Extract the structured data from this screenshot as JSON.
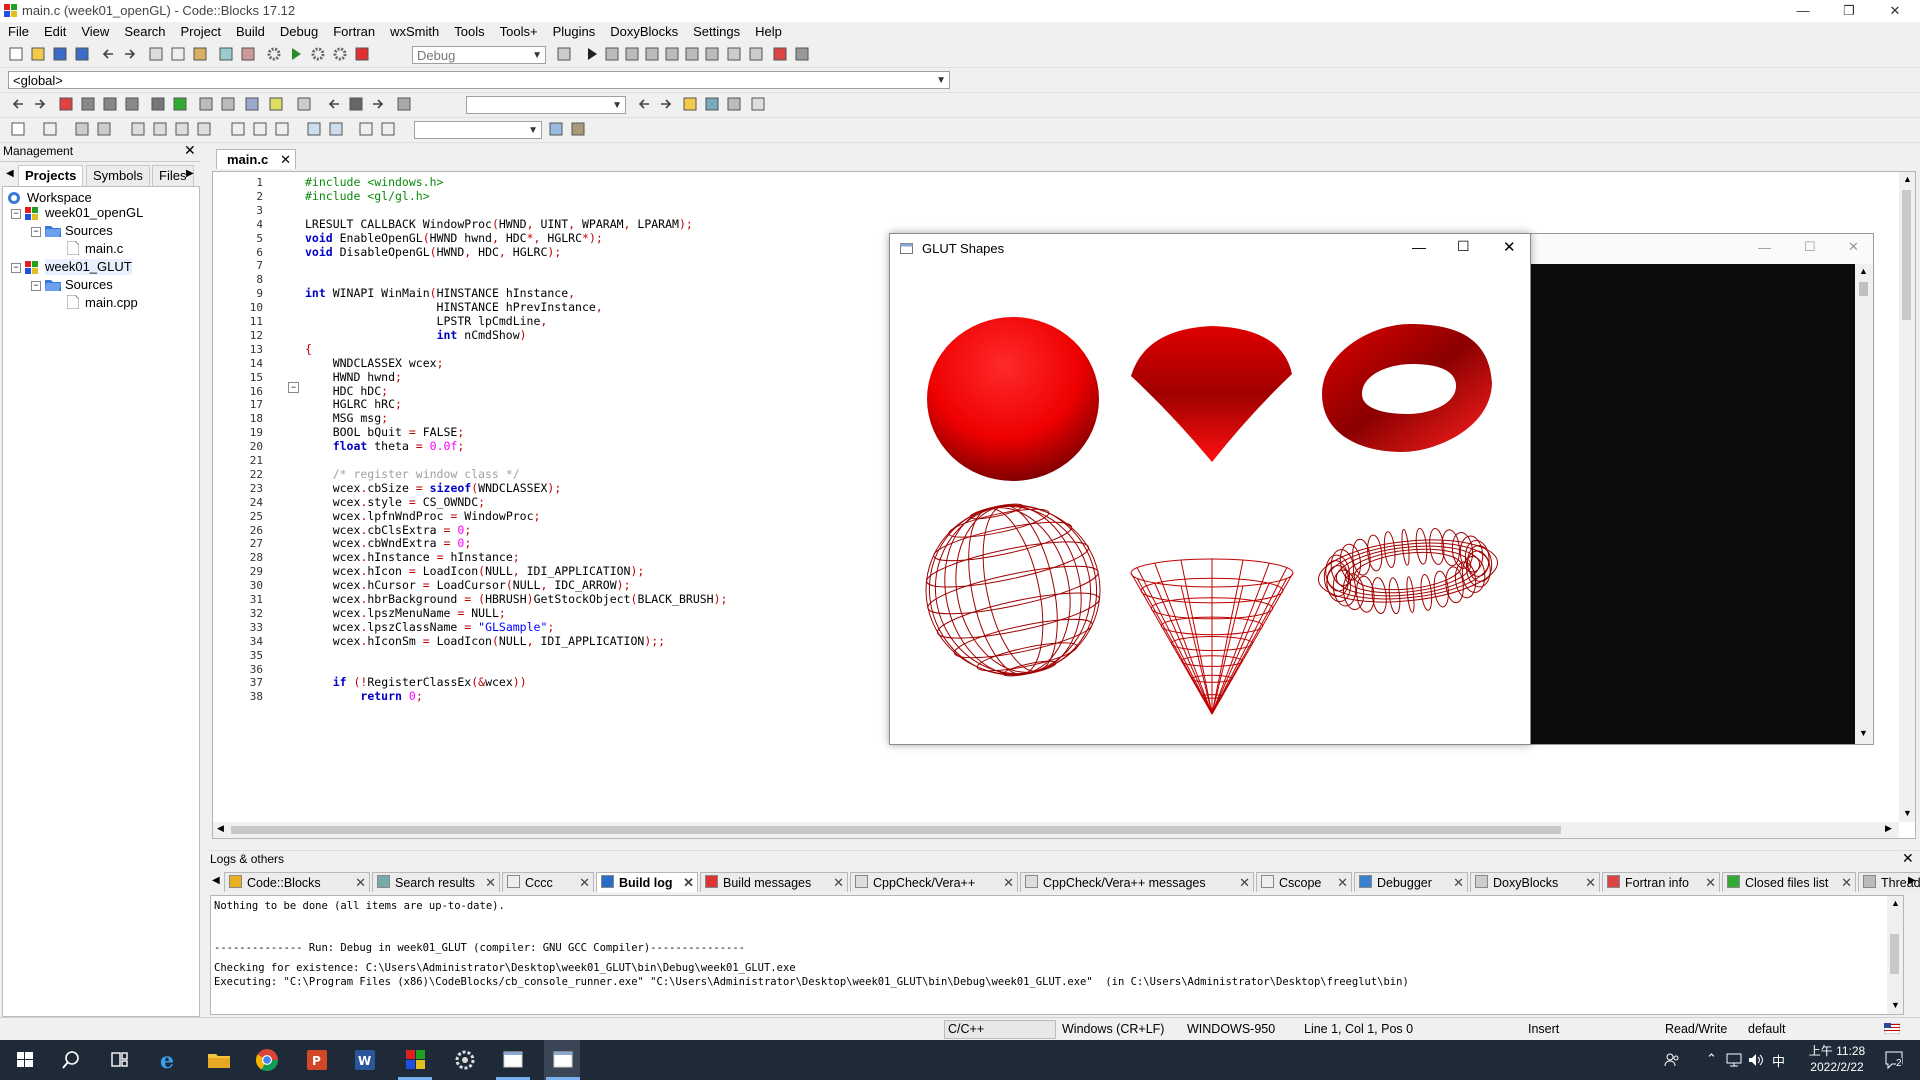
{
  "window": {
    "title": "main.c (week01_openGL) - Code::Blocks 17.12",
    "controls": [
      "—",
      "❐",
      "✕"
    ]
  },
  "menu": [
    "File",
    "Edit",
    "View",
    "Search",
    "Project",
    "Build",
    "Debug",
    "Fortran",
    "wxSmith",
    "Tools",
    "Tools+",
    "Plugins",
    "DoxyBlocks",
    "Settings",
    "Help"
  ],
  "toolbar": {
    "build_target": "Debug",
    "scope": "<global>",
    "search_value": "",
    "symbol_value": ""
  },
  "management": {
    "title": "Management",
    "tabs": [
      "Projects",
      "Symbols",
      "Files"
    ],
    "tree": [
      {
        "label": "Workspace",
        "level": 0
      },
      {
        "label": "week01_openGL",
        "level": 1
      },
      {
        "label": "Sources",
        "level": 2
      },
      {
        "label": "main.c",
        "level": 3
      },
      {
        "label": "week01_GLUT",
        "level": 1
      },
      {
        "label": "Sources",
        "level": 2
      },
      {
        "label": "main.cpp",
        "level": 3
      }
    ]
  },
  "editor": {
    "tab": "main.c",
    "lines": [
      "#include <windows.h>",
      "#include <gl/gl.h>",
      "",
      "LRESULT CALLBACK WindowProc(HWND, UINT, WPARAM, LPARAM);",
      "void EnableOpenGL(HWND hwnd, HDC*, HGLRC*);",
      "void DisableOpenGL(HWND, HDC, HGLRC);",
      "",
      "",
      "int WINAPI WinMain(HINSTANCE hInstance,",
      "                   HINSTANCE hPrevInstance,",
      "                   LPSTR lpCmdLine,",
      "                   int nCmdShow)",
      "{",
      "    WNDCLASSEX wcex;",
      "    HWND hwnd;",
      "    HDC hDC;",
      "    HGLRC hRC;",
      "    MSG msg;",
      "    BOOL bQuit = FALSE;",
      "    float theta = 0.0f;",
      "",
      "    /* register window class */",
      "    wcex.cbSize = sizeof(WNDCLASSEX);",
      "    wcex.style = CS_OWNDC;",
      "    wcex.lpfnWndProc = WindowProc;",
      "    wcex.cbClsExtra = 0;",
      "    wcex.cbWndExtra = 0;",
      "    wcex.hInstance = hInstance;",
      "    wcex.hIcon = LoadIcon(NULL, IDI_APPLICATION);",
      "    wcex.hCursor = LoadCursor(NULL, IDC_ARROW);",
      "    wcex.hbrBackground = (HBRUSH)GetStockObject(BLACK_BRUSH);",
      "    wcex.lpszMenuName = NULL;",
      "    wcex.lpszClassName = \"GLSample\";",
      "    wcex.hIconSm = LoadIcon(NULL, IDI_APPLICATION);;",
      "",
      "",
      "    if (!RegisterClassEx(&wcex))",
      "        return 0;"
    ]
  },
  "glut_window": {
    "title": "GLUT Shapes",
    "shapes": [
      "solid-sphere",
      "solid-cone",
      "solid-torus",
      "wire-sphere",
      "wire-cone",
      "wire-torus"
    ],
    "shape_color": "#e00000"
  },
  "logs": {
    "title": "Logs & others",
    "tabs": [
      "Code::Blocks",
      "Search results",
      "Cccc",
      "Build log",
      "Build messages",
      "CppCheck/Vera++",
      "CppCheck/Vera++ messages",
      "Cscope",
      "Debugger",
      "DoxyBlocks",
      "Fortran info",
      "Closed files list",
      "Thread"
    ],
    "active_tab": "Build log",
    "lines": [
      "Nothing to be done (all items are up-to-date).",
      "",
      "",
      "-------------- Run: Debug in week01_GLUT (compiler: GNU GCC Compiler)---------------",
      "",
      "Checking for existence: C:\\Users\\Administrator\\Desktop\\week01_GLUT\\bin\\Debug\\week01_GLUT.exe",
      "Executing: \"C:\\Program Files (x86)\\CodeBlocks/cb_console_runner.exe\" \"C:\\Users\\Administrator\\Desktop\\week01_GLUT\\bin\\Debug\\week01_GLUT.exe\"  (in C:\\Users\\Administrator\\Desktop\\freeglut\\bin)"
    ]
  },
  "status": {
    "language": "C/C++",
    "eol": "Windows (CR+LF)",
    "encoding": "WINDOWS-950",
    "position": "Line 1, Col 1, Pos 0",
    "mode": "Insert",
    "access": "Read/Write",
    "profile": "default"
  },
  "taskbar": {
    "ime": "中",
    "time": "上午 11:28",
    "date": "2022/2/22",
    "notifications": "2"
  }
}
